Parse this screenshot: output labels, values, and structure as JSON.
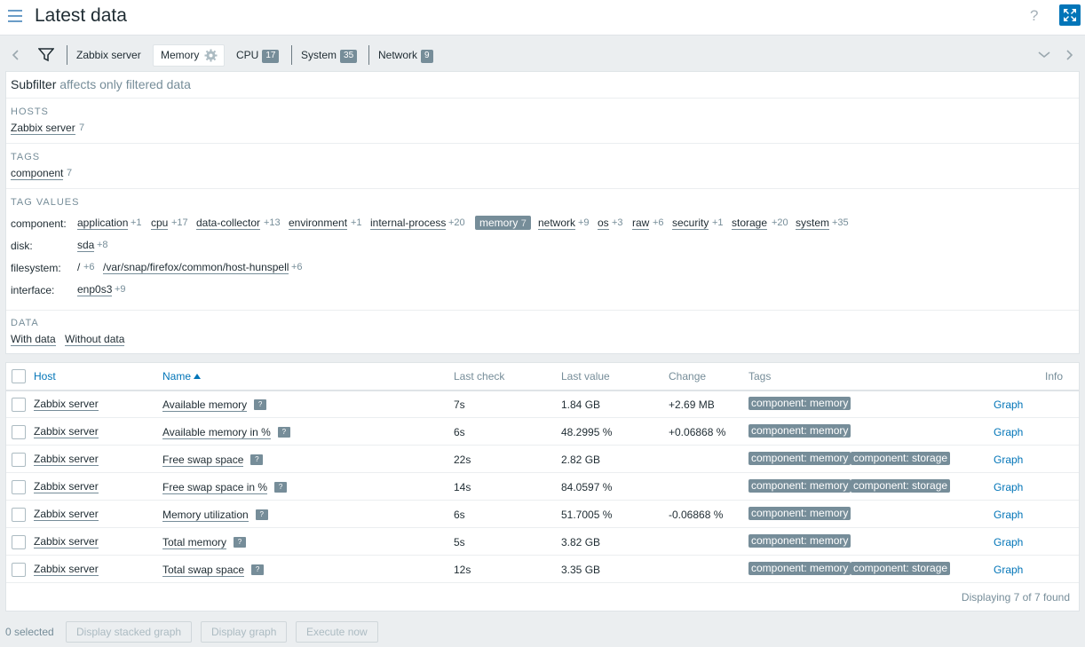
{
  "page": {
    "title": "Latest data",
    "help_label": "?"
  },
  "tabs": {
    "items": [
      {
        "label": "Zabbix server",
        "count": ""
      },
      {
        "label": "Memory",
        "count": ""
      },
      {
        "label": "CPU",
        "count": "17"
      },
      {
        "label": "System",
        "count": "35"
      },
      {
        "label": "Network",
        "count": "9"
      }
    ]
  },
  "subfilter": {
    "title": "Subfilter",
    "note": "affects only filtered data",
    "hosts": {
      "heading": "HOSTS",
      "items": [
        {
          "label": "Zabbix server",
          "count": "7"
        }
      ]
    },
    "tags": {
      "heading": "TAGS",
      "items": [
        {
          "label": "component",
          "count": "7"
        }
      ]
    },
    "tag_values": {
      "heading": "TAG VALUES",
      "rows": [
        {
          "name": "component:",
          "values": [
            {
              "label": "application",
              "count": "+1"
            },
            {
              "label": "cpu",
              "count": "+17"
            },
            {
              "label": "data-collector",
              "count": "+13"
            },
            {
              "label": "environment",
              "count": "+1"
            },
            {
              "label": "internal-process",
              "count": "+20"
            },
            {
              "label": "memory",
              "count": "7"
            },
            {
              "label": "network",
              "count": "+9"
            },
            {
              "label": "os",
              "count": "+3"
            },
            {
              "label": "raw",
              "count": "+6"
            },
            {
              "label": "security",
              "count": "+1"
            },
            {
              "label": "storage",
              "count": "+20"
            },
            {
              "label": "system",
              "count": "+35"
            }
          ]
        },
        {
          "name": "disk:",
          "values": [
            {
              "label": "sda",
              "count": "+8"
            }
          ]
        },
        {
          "name": "filesystem:",
          "values": [
            {
              "label": "/",
              "count": "+6"
            },
            {
              "label": "/var/snap/firefox/common/host-hunspell",
              "count": "+6"
            }
          ]
        },
        {
          "name": "interface:",
          "values": [
            {
              "label": "enp0s3",
              "count": "+9"
            }
          ]
        }
      ]
    },
    "data": {
      "heading": "DATA",
      "items": [
        {
          "label": "With data"
        },
        {
          "label": "Without data"
        }
      ]
    }
  },
  "table": {
    "headers": {
      "host": "Host",
      "name": "Name",
      "last_check": "Last check",
      "last_value": "Last value",
      "change": "Change",
      "tags": "Tags",
      "info": "Info"
    },
    "rows": [
      {
        "host": "Zabbix server",
        "name": "Available memory",
        "last_check": "7s",
        "last_value": "1.84 GB",
        "change": "+2.69 MB",
        "tags": [
          "component: memory"
        ],
        "graph": "Graph"
      },
      {
        "host": "Zabbix server",
        "name": "Available memory in %",
        "last_check": "6s",
        "last_value": "48.2995 %",
        "change": "+0.06868 %",
        "tags": [
          "component: memory"
        ],
        "graph": "Graph"
      },
      {
        "host": "Zabbix server",
        "name": "Free swap space",
        "last_check": "22s",
        "last_value": "2.82 GB",
        "change": "",
        "tags": [
          "component: memory",
          "component: storage"
        ],
        "graph": "Graph"
      },
      {
        "host": "Zabbix server",
        "name": "Free swap space in %",
        "last_check": "14s",
        "last_value": "84.0597 %",
        "change": "",
        "tags": [
          "component: memory",
          "component: storage"
        ],
        "graph": "Graph"
      },
      {
        "host": "Zabbix server",
        "name": "Memory utilization",
        "last_check": "6s",
        "last_value": "51.7005 %",
        "change": "-0.06868 %",
        "tags": [
          "component: memory"
        ],
        "graph": "Graph"
      },
      {
        "host": "Zabbix server",
        "name": "Total memory",
        "last_check": "5s",
        "last_value": "3.82 GB",
        "change": "",
        "tags": [
          "component: memory"
        ],
        "graph": "Graph"
      },
      {
        "host": "Zabbix server",
        "name": "Total swap space",
        "last_check": "12s",
        "last_value": "3.35 GB",
        "change": "",
        "tags": [
          "component: memory",
          "component: storage"
        ],
        "graph": "Graph"
      }
    ],
    "found_text": "Displaying 7 of 7 found"
  },
  "footer": {
    "selected": "0 selected",
    "stacked_graph": "Display stacked graph",
    "display_graph": "Display graph",
    "execute_now": "Execute now"
  }
}
